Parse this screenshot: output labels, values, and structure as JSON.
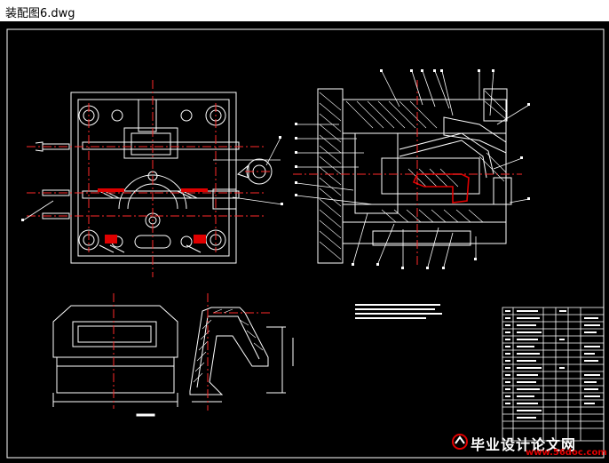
{
  "window": {
    "title": "装配图6.dwg"
  },
  "drawing": {
    "colors": {
      "line": "#ffffff",
      "center": "#ff2a2a",
      "background": "#000000",
      "highlight": "#e00000"
    }
  },
  "watermark": {
    "text": "毕业设计论文网",
    "url": "www.56doc.com",
    "logo": "logo-icon"
  }
}
